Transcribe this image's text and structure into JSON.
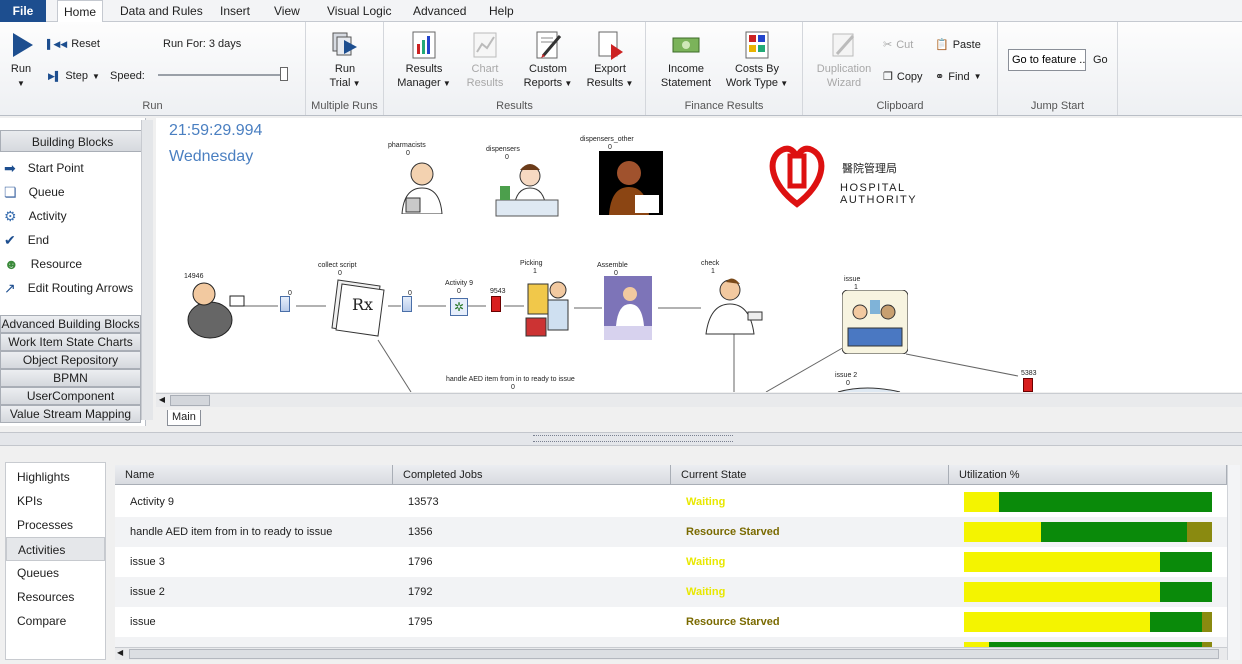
{
  "menubar": {
    "file": "File",
    "tabs": [
      "Home",
      "Data and Rules",
      "Insert",
      "View",
      "Visual Logic",
      "Advanced",
      "Help"
    ]
  },
  "ribbon": {
    "run_group": {
      "label": "Run",
      "run": "Run",
      "reset": "Reset",
      "step": "Step",
      "run_for": "Run For: 3 days",
      "speed": "Speed:",
      "speed_level_fraction": 1.0
    },
    "multiple_runs": {
      "label": "Multiple Runs",
      "run_trial_1": "Run",
      "run_trial_2": "Trial"
    },
    "results": {
      "label": "Results",
      "results_manager_1": "Results",
      "results_manager_2": "Manager",
      "chart_results_1": "Chart",
      "chart_results_2": "Results",
      "custom_reports_1": "Custom",
      "custom_reports_2": "Reports",
      "export_results_1": "Export",
      "export_results_2": "Results"
    },
    "finance": {
      "label": "Finance Results",
      "income_1": "Income",
      "income_2": "Statement",
      "costs_1": "Costs By",
      "costs_2": "Work Type"
    },
    "clipboard": {
      "label": "Clipboard",
      "dup_1": "Duplication",
      "dup_2": "Wizard",
      "cut": "Cut",
      "copy": "Copy",
      "paste": "Paste",
      "find": "Find"
    },
    "jump_start": {
      "label": "Jump Start",
      "input_value": "Go to feature ..",
      "go": "Go"
    }
  },
  "palette": {
    "header": "Building Blocks",
    "items": [
      "Start Point",
      "Queue",
      "Activity",
      "End",
      "Resource",
      "Edit Routing Arrows"
    ],
    "sections": [
      "Advanced Building Blocks",
      "Work Item State Charts",
      "Object Repository",
      "BPMN",
      "UserComponent",
      "Value Stream Mapping"
    ]
  },
  "canvas": {
    "clock": "21:59:29.994",
    "day": "Wednesday",
    "logo_chinese": "醫院管理局",
    "logo_1": "HOSPITAL",
    "logo_2": "AUTHORITY",
    "resources": [
      {
        "name": "pharmacists",
        "count": "0"
      },
      {
        "name": "dispensers",
        "count": "0"
      },
      {
        "name": "dispensers_other",
        "count": "0"
      }
    ],
    "start_count": "14946",
    "q1": "0",
    "collect_script": "collect script",
    "collect_script_count": "0",
    "q2": "0",
    "activity9": "Activity 9",
    "activity9_count": "0",
    "red1": "9543",
    "picking": "Picking",
    "picking_count": "1",
    "assemble": "Assemble",
    "assemble_count": "0",
    "check": "check",
    "check_count": "1",
    "issue": "issue",
    "issue_count": "1",
    "issue2": "issue 2",
    "issue2_count": "0",
    "red2": "5383",
    "handle": "handle AED item from in to ready to issue",
    "handle_count": "0",
    "main_tab": "Main"
  },
  "results_nav": [
    "Highlights",
    "KPIs",
    "Processes",
    "Activities",
    "Queues",
    "Resources",
    "Compare"
  ],
  "grid": {
    "columns": [
      "Name",
      "Completed Jobs",
      "Current State",
      "Utilization %"
    ],
    "rows": [
      {
        "name": "Activity 9",
        "jobs": "13573",
        "state": "Waiting",
        "util": [
          0.14,
          0.86,
          0.0
        ]
      },
      {
        "name": "handle AED item from in to ready to issue",
        "jobs": "1356",
        "state": "Resource Starved",
        "util": [
          0.31,
          0.59,
          0.1
        ]
      },
      {
        "name": "issue 3",
        "jobs": "1796",
        "state": "Waiting",
        "util": [
          0.79,
          0.21,
          0.0
        ]
      },
      {
        "name": "issue 2",
        "jobs": "1792",
        "state": "Waiting",
        "util": [
          0.79,
          0.21,
          0.0
        ]
      },
      {
        "name": "issue",
        "jobs": "1795",
        "state": "Resource Starved",
        "util": [
          0.75,
          0.21,
          0.04
        ]
      },
      {
        "name": "",
        "jobs": "",
        "state": "",
        "util": [
          0.1,
          0.86,
          0.04
        ]
      }
    ]
  },
  "colors": {
    "waiting": "#e8e800",
    "starved": "#7a6a00",
    "bar_yellow": "#f4f400",
    "bar_green": "#0a8a0a",
    "bar_olive": "#8a8a10",
    "accent": "#1d4e8f"
  }
}
